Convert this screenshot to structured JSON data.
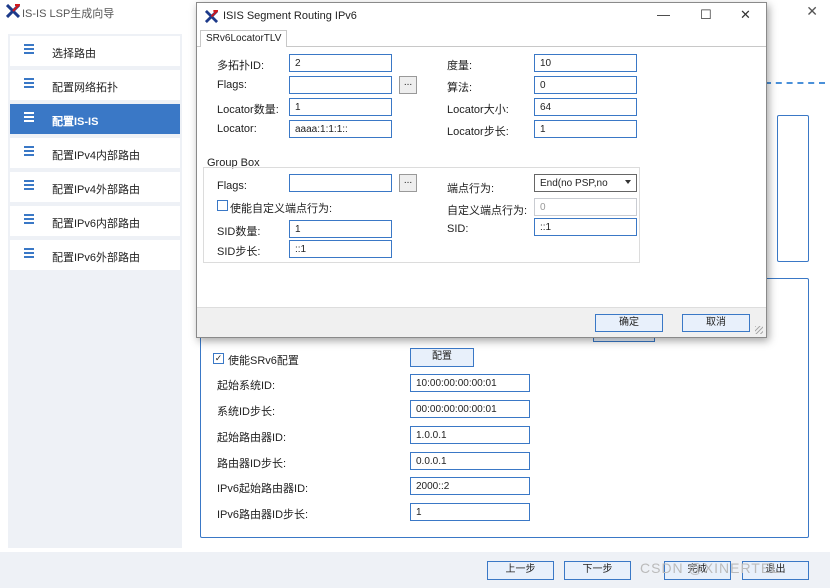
{
  "app": {
    "title": "IS-IS LSP生成向导",
    "close_glyph": "✕",
    "logo": "xinertel-logo"
  },
  "sidebar": {
    "items": [
      {
        "label": "选择路由"
      },
      {
        "label": "配置网络拓扑"
      },
      {
        "label": "配置IS-IS"
      },
      {
        "label": "配置IPv4内部路由"
      },
      {
        "label": "配置IPv4外部路由"
      },
      {
        "label": "配置IPv6内部路由"
      },
      {
        "label": "配置IPv6外部路由"
      }
    ],
    "active_index": 2
  },
  "srv6": {
    "enable_label": "使能SRv6配置",
    "enable_checked": "✓",
    "config_button": "配置",
    "fields": [
      {
        "label": "起始系统ID:",
        "value": "10:00:00:00:00:01"
      },
      {
        "label": "系统ID步长:",
        "value": "00:00:00:00:00:01"
      },
      {
        "label": "起始路由器ID:",
        "value": "1.0.0.1"
      },
      {
        "label": "路由器ID步长:",
        "value": "0.0.0.1"
      },
      {
        "label": "IPv6起始路由器ID:",
        "value": "2000::2"
      },
      {
        "label": "IPv6路由器ID步长:",
        "value": "1"
      }
    ]
  },
  "footer": {
    "prev": "上一步",
    "next": "下一步",
    "finish": "完成",
    "exit": "退出"
  },
  "watermark": "CSDN @XINERTEL",
  "dialog": {
    "title": "ISIS Segment Routing IPv6",
    "controls": {
      "minimize": "—",
      "maximize": "☐",
      "close": "✕"
    },
    "tab": "SRv6LocatorTLV",
    "locator": {
      "mt_id": {
        "label": "多拓扑ID:",
        "value": "2"
      },
      "metric": {
        "label": "度量:",
        "value": "10"
      },
      "flags": {
        "label": "Flags:",
        "value": "",
        "btn": "..."
      },
      "algorithm": {
        "label": "算法:",
        "value": "0"
      },
      "locator_count": {
        "label": "Locator数量:",
        "value": "1"
      },
      "locator_size": {
        "label": "Locator大小:",
        "value": "64"
      },
      "locator": {
        "label": "Locator:",
        "value": "aaaa:1:1:1::"
      },
      "locator_step": {
        "label": "Locator步长:",
        "value": "1"
      }
    },
    "group": {
      "title": "Group Box",
      "flags": {
        "label": "Flags:",
        "value": "",
        "btn": "..."
      },
      "endpoint_behavior": {
        "label": "端点行为:",
        "value": "End(no PSP,no"
      },
      "custom_enable": {
        "label": "使能自定义端点行为:",
        "checked": false
      },
      "custom_behavior": {
        "label": "自定义端点行为:",
        "value": "0"
      },
      "sid_count": {
        "label": "SID数量:",
        "value": "1"
      },
      "sid": {
        "label": "SID:",
        "value": "::1"
      },
      "sid_step": {
        "label": "SID步长:",
        "value": "::1"
      }
    },
    "ok": "确定",
    "cancel": "取消"
  },
  "colors": {
    "accent": "#3a78c6",
    "sidebar_bg": "#eef1f6"
  }
}
